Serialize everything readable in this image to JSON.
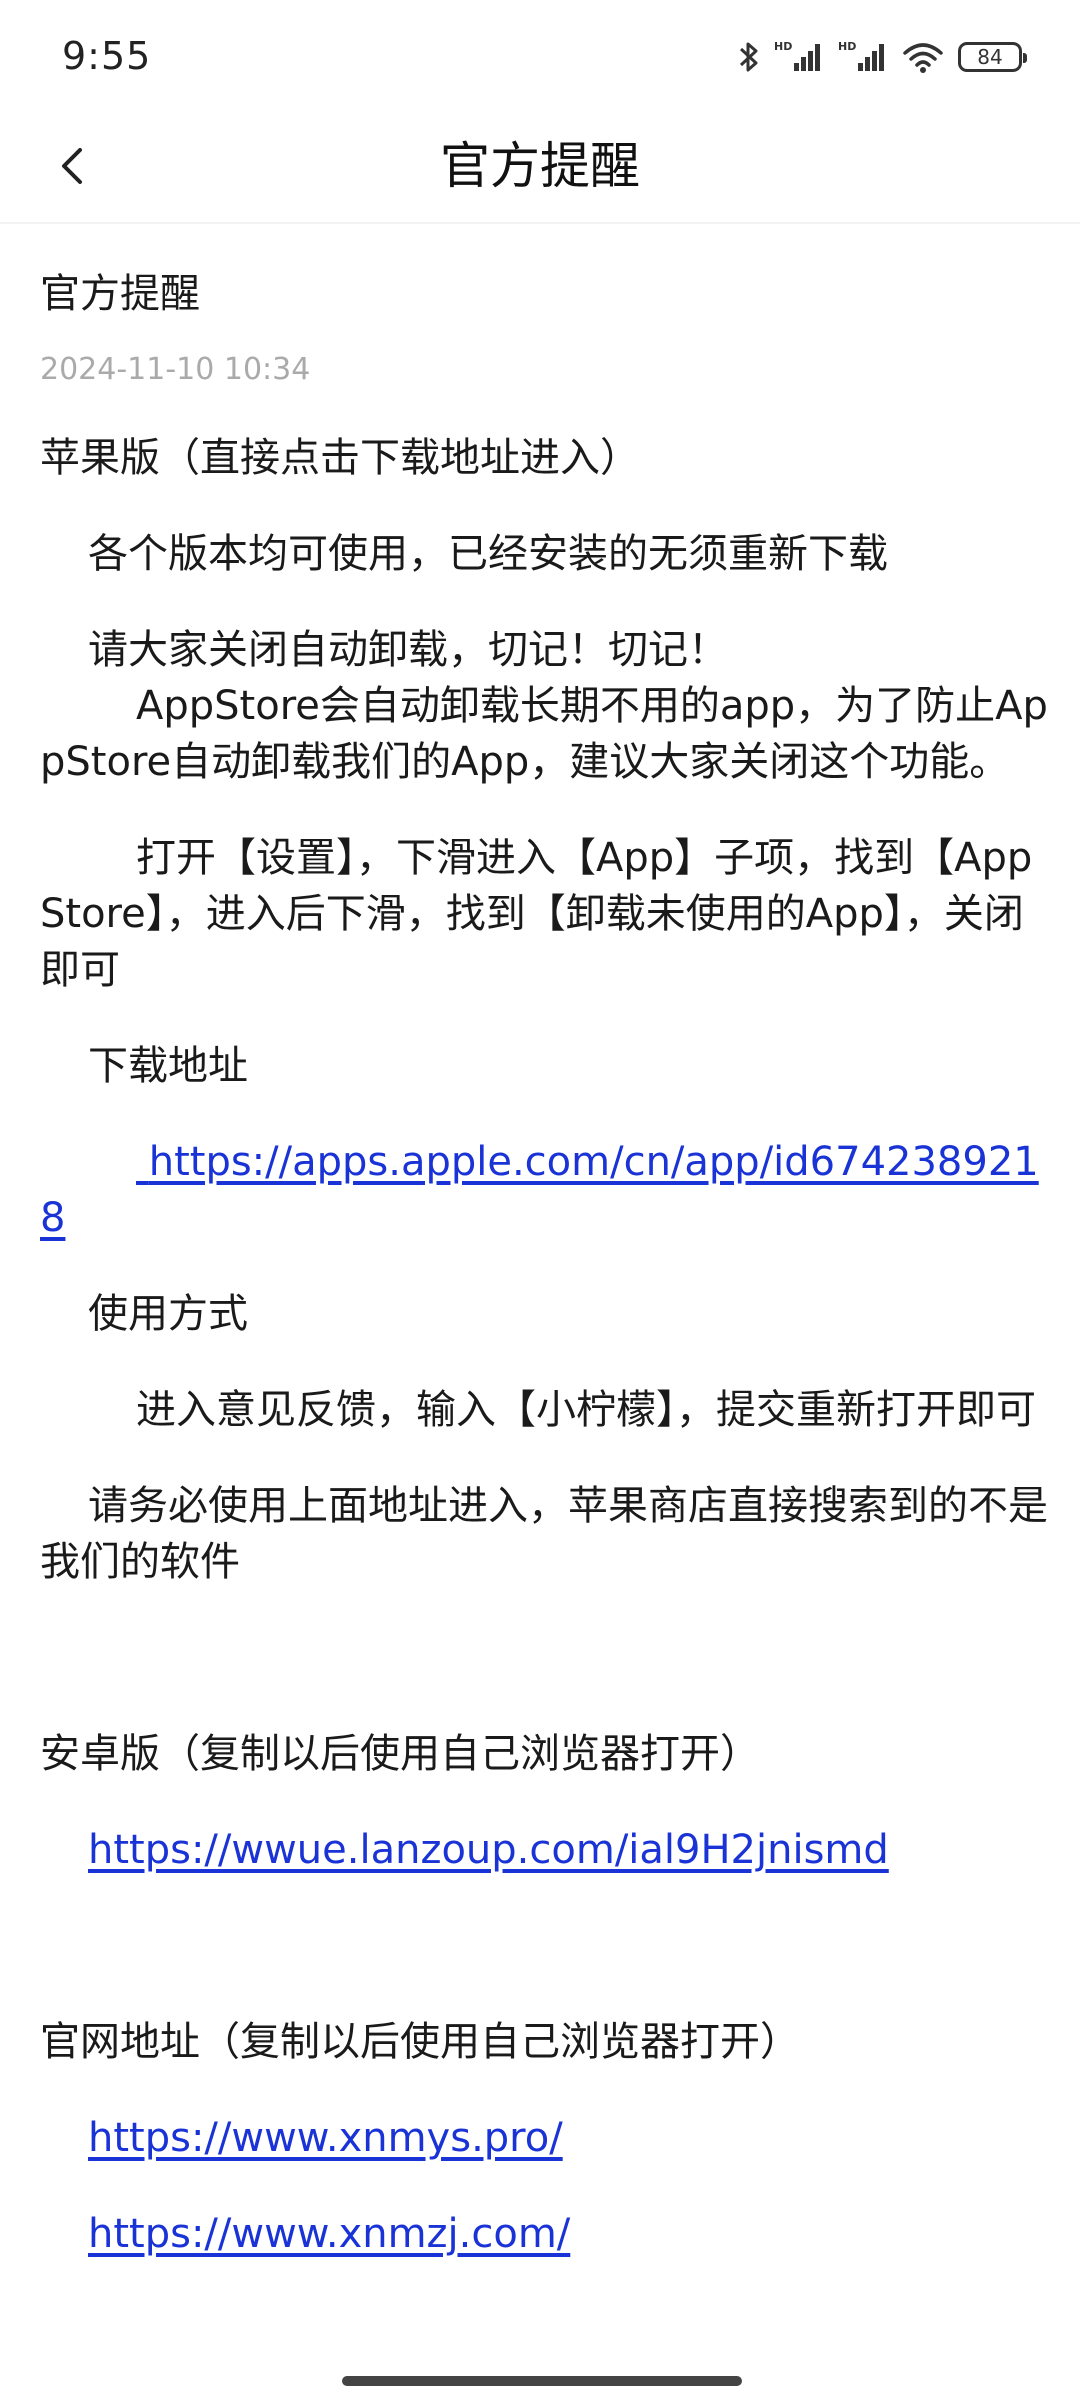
{
  "status_bar": {
    "time": "9:55",
    "battery": "84",
    "icons": [
      "bluetooth-icon",
      "hd-signal-icon",
      "hd-signal-icon",
      "wifi-icon",
      "battery-icon"
    ]
  },
  "header": {
    "title": "官方提醒",
    "back_icon": "chevron-left-icon"
  },
  "article": {
    "title": "官方提醒",
    "date": "2024-11-10 10:34",
    "ios_heading": "苹果版（直接点击下载地址进入）",
    "ios_line1": "各个版本均可使用，已经安装的无须重新下载",
    "ios_line2": "请大家关闭自动卸载，切记！切记！",
    "ios_line3": "AppStore会自动卸载长期不用的app，为了防止AppStore自动卸载我们的App，建议大家关闭这个功能。",
    "ios_line4": "打开【设置】，下滑进入【App】子项，找到【App Store】，进入后下滑，找到【卸载未使用的App】，关闭即可",
    "download_label": "下载地址",
    "ios_link": " https://apps.apple.com/cn/app/id6742389218",
    "usage_label": "使用方式",
    "usage_text": "进入意见反馈，输入【小柠檬】，提交重新打开即可",
    "warning": "请务必使用上面地址进入，苹果商店直接搜索到的不是我们的软件",
    "android_heading": "安卓版（复制以后使用自己浏览器打开）",
    "android_link": "https://wwue.lanzoup.com/ial9H2jnismd",
    "site_heading": "官网地址（复制以后使用自己浏览器打开）",
    "site_link1": "https://www.xnmys.pro/",
    "site_link2": "https://www.xnmzj.com/"
  }
}
